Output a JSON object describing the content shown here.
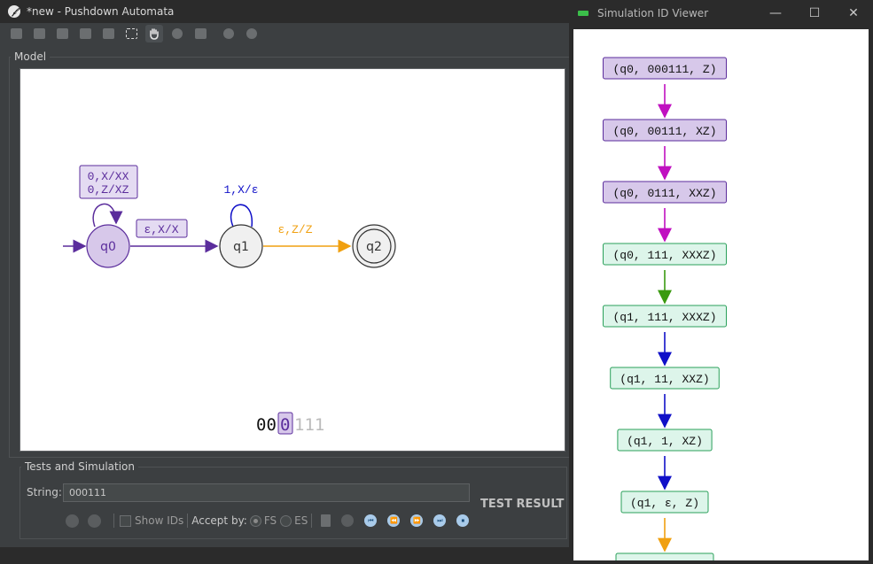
{
  "main_window": {
    "title": "*new - Pushdown Automata",
    "logo_glyph": "𝒻"
  },
  "toolbar": {
    "icons": [
      "new-file-icon",
      "open-folder-icon",
      "save-icon",
      "save-as-icon",
      "export-icon",
      "select-tool-icon",
      "hand-tool-icon",
      "add-state-icon",
      "add-transition-icon",
      "record-icon",
      "nondeterminism-icon"
    ]
  },
  "model": {
    "label": "Model",
    "states": [
      {
        "name": "q0",
        "initial": true,
        "final": false,
        "active": true
      },
      {
        "name": "q1",
        "initial": false,
        "final": false,
        "active": false
      },
      {
        "name": "q2",
        "initial": false,
        "final": true,
        "active": false
      }
    ],
    "transitions": {
      "q0_loop": [
        "0,X/XX",
        "0,Z/XZ"
      ],
      "q0_q1": "ε,X/X",
      "q1_loop": "1,X/ε",
      "q1_q2": "ε,Z/Z"
    },
    "tape": {
      "consumed": "00",
      "current": "0",
      "remaining": "111"
    },
    "colors": {
      "active_state": "#d7c8ea",
      "active_border": "#5b2d9c",
      "purple": "#5b2d9c",
      "blue": "#1010c8",
      "orange": "#f0a010"
    }
  },
  "tests": {
    "label": "Tests and Simulation",
    "string_label": "String:",
    "string_value": "000111",
    "show_ids_label": "Show IDs",
    "accept_by_label": "Accept by:",
    "fs_label": "FS",
    "es_label": "ES",
    "test_result": "TEST RESULT"
  },
  "sim_viewer": {
    "title": "Simulation ID Viewer",
    "minimize": "—",
    "maximize": "☐",
    "close": "✕",
    "ids": [
      {
        "text": "(q0, 000111, Z)",
        "style": "purple"
      },
      {
        "text": "(q0, 00111, XZ)",
        "style": "purple"
      },
      {
        "text": "(q0, 0111, XXZ)",
        "style": "purple"
      },
      {
        "text": "(q0, 111, XXXZ)",
        "style": "green"
      },
      {
        "text": "(q1, 111, XXXZ)",
        "style": "green"
      },
      {
        "text": "(q1, 11, XXZ)",
        "style": "green"
      },
      {
        "text": "(q1, 1, XZ)",
        "style": "green"
      },
      {
        "text": "(q1, ε, Z)",
        "style": "green"
      }
    ],
    "arrow_colors": [
      "#c010c0",
      "#c010c0",
      "#c010c0",
      "#3a9a10",
      "#1010c8",
      "#1010c8",
      "#1010c8",
      "#f0a010"
    ]
  }
}
